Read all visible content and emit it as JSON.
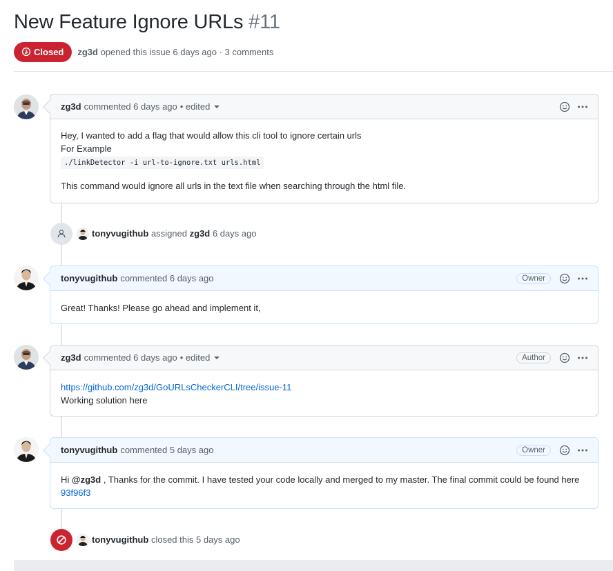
{
  "issue": {
    "title": "New Feature Ignore URLs",
    "number": "#11",
    "state": "Closed",
    "author": "zg3d",
    "meta_text": "opened this issue 6 days ago · 3 comments"
  },
  "comments": [
    {
      "author": "zg3d",
      "action": "commented 6 days ago",
      "edited": "• edited",
      "role": "",
      "body": {
        "line1": "Hey, I wanted to add a flag that would allow this cli tool to ignore certain urls",
        "line2": "For Example",
        "code": "./linkDetector -i url-to-ignore.txt urls.html",
        "line3": "This command would ignore all urls in the text file when searching through the html file."
      }
    },
    {
      "author": "tonyvugithub",
      "action": "commented 6 days ago",
      "role": "Owner",
      "body": {
        "line1": "Great! Thanks! Please go ahead and implement it,"
      }
    },
    {
      "author": "zg3d",
      "action": "commented 6 days ago",
      "edited": "• edited",
      "role": "Author",
      "body": {
        "link": "https://github.com/zg3d/GoURLsCheckerCLI/tree/issue-11",
        "line2": "Working solution here"
      }
    },
    {
      "author": "tonyvugithub",
      "action": "commented 5 days ago",
      "role": "Owner",
      "body": {
        "prefix": "Hi",
        "mention": "@zg3d",
        "text": ", Thanks for the commit. I have tested your code locally and merged to my master. The final commit could be found here",
        "commit_link": "93f96f3"
      }
    }
  ],
  "events": [
    {
      "actor": "tonyvugithub",
      "action": "assigned",
      "target": "zg3d",
      "time": "6 days ago"
    },
    {
      "actor": "tonyvugithub",
      "action": "closed this",
      "time": "5 days ago"
    }
  ],
  "icons": {
    "state": "issue-closed-icon",
    "emoji": "smiley-icon",
    "more": "kebab-horizontal-icon",
    "assign": "person-icon",
    "close": "circle-slash-icon"
  },
  "colors": {
    "closed_red": "#cb2431",
    "link_blue": "#0366d6",
    "owner_blue": "#f1f8ff"
  }
}
